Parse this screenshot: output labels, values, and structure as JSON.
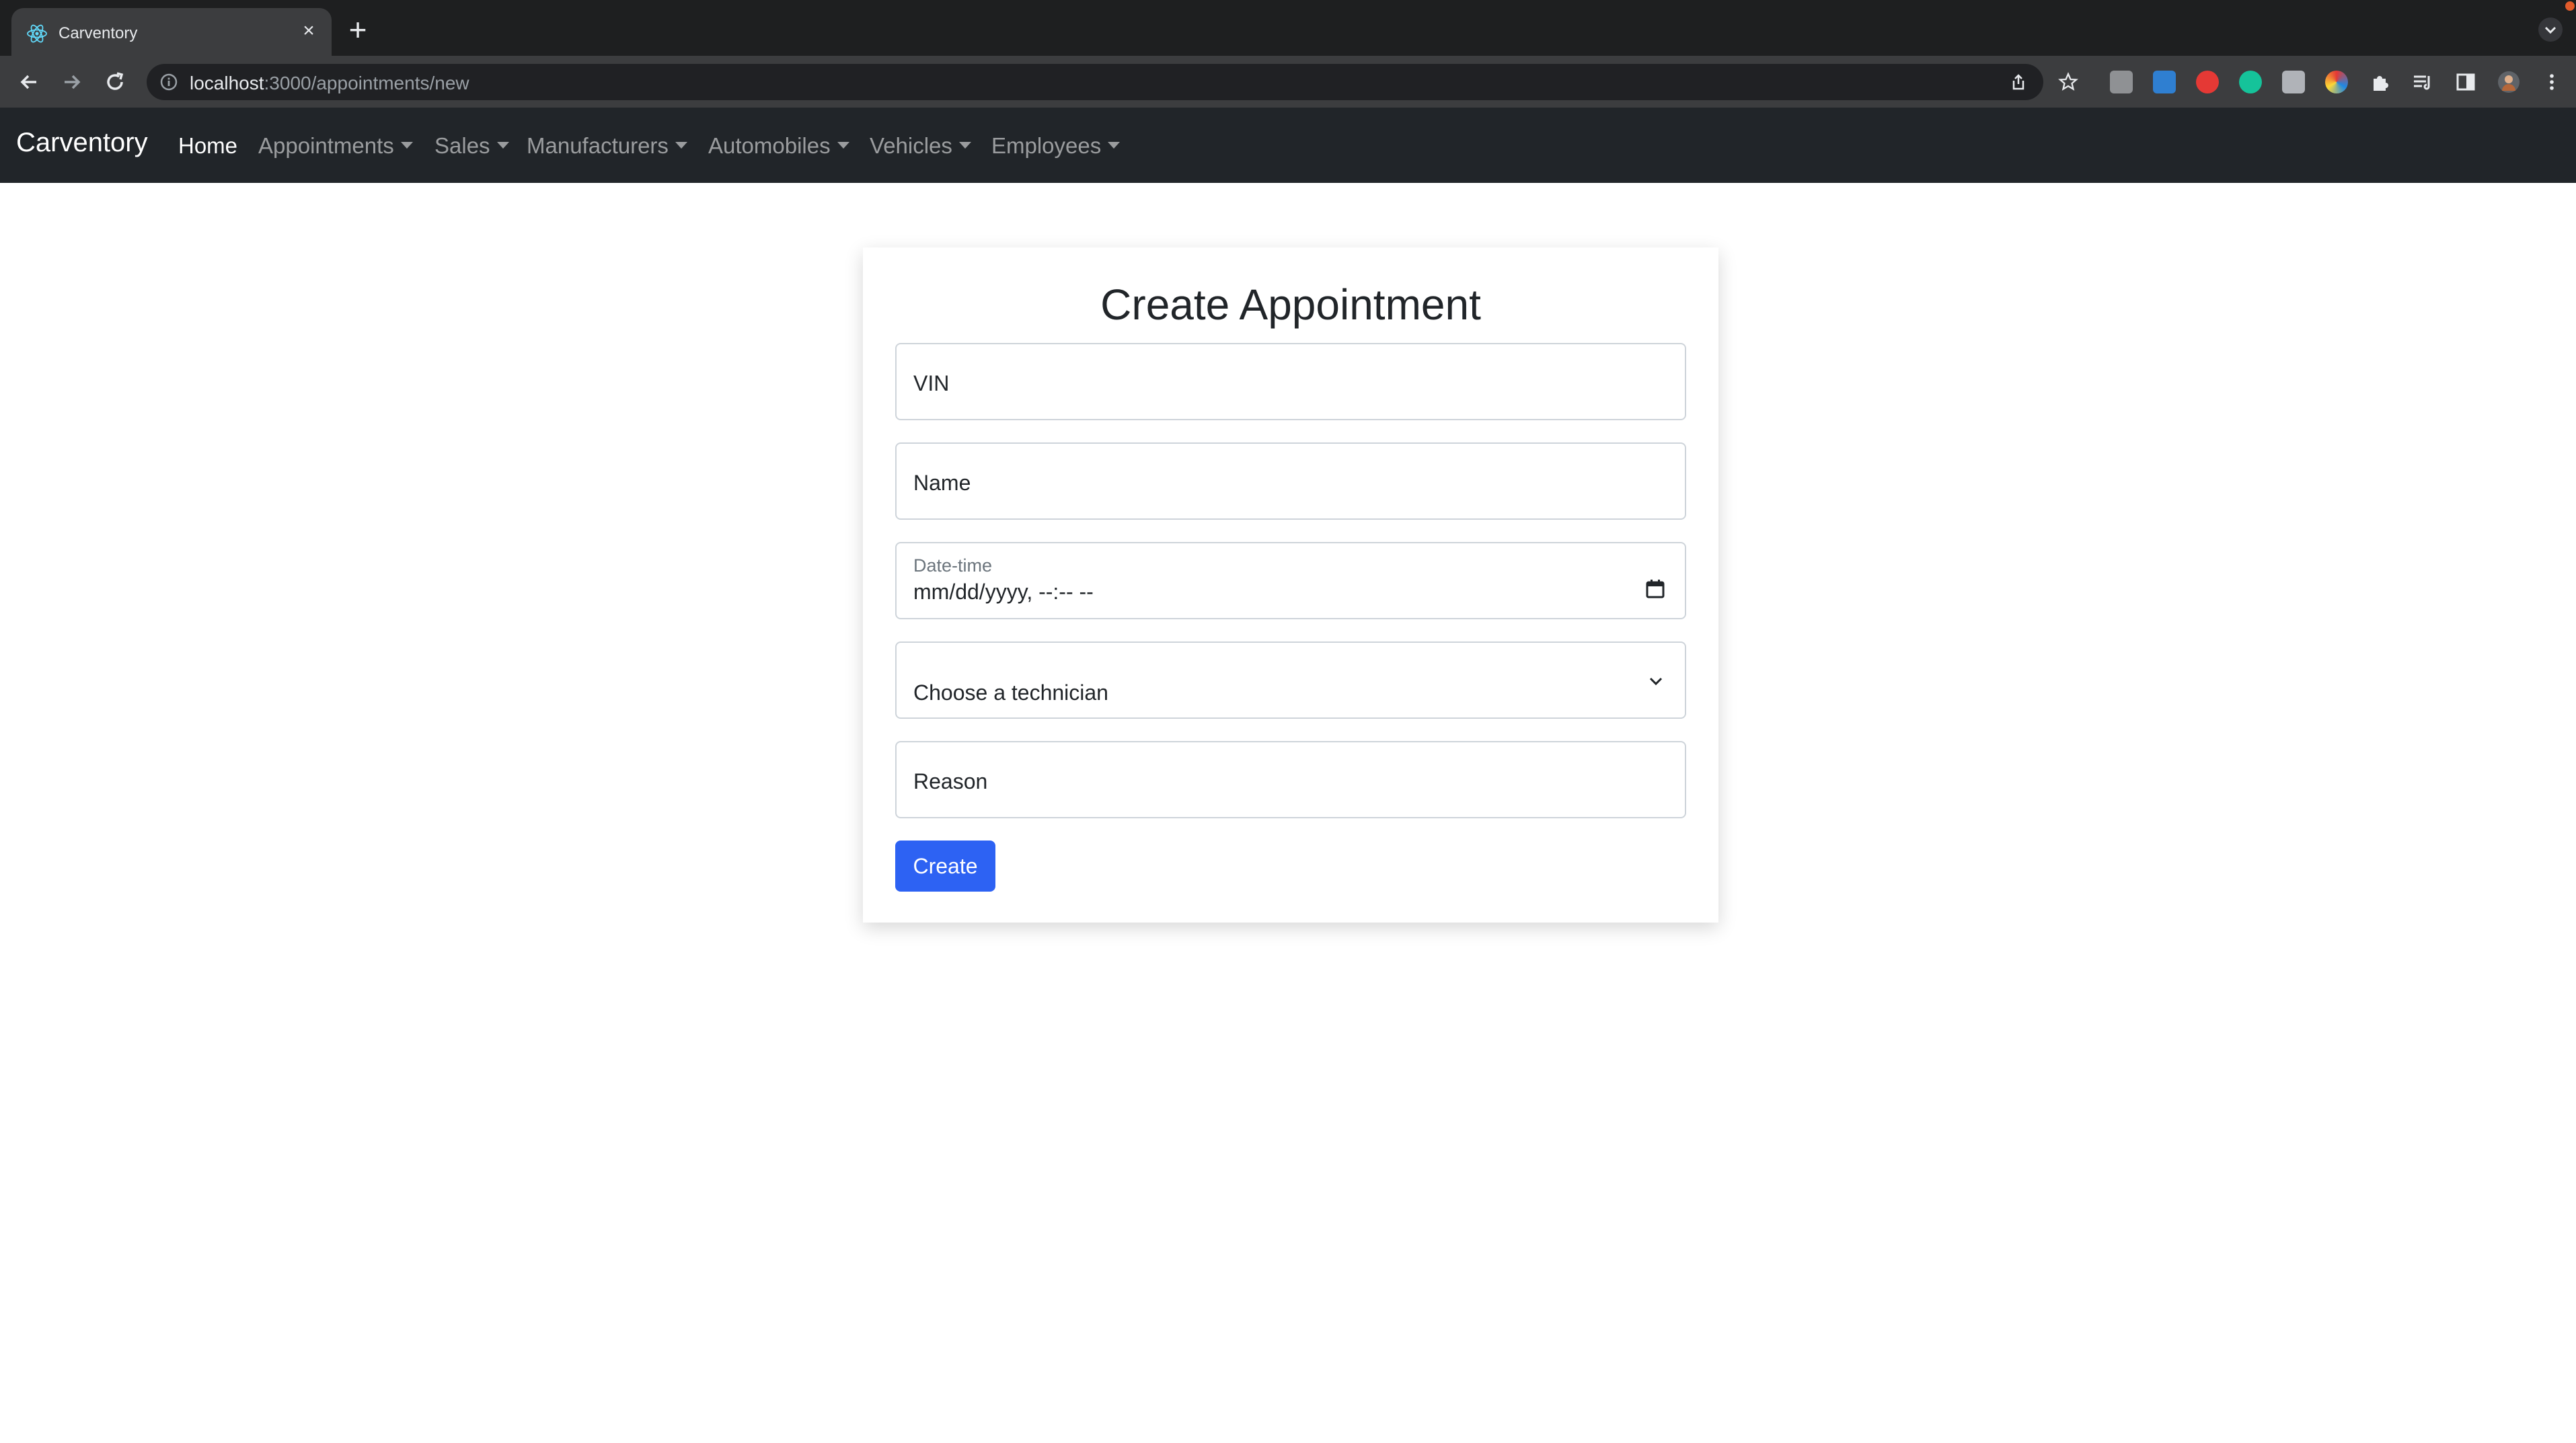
{
  "browser": {
    "tab_title": "Carventory",
    "url_host": "localhost",
    "url_path": ":3000/appointments/new",
    "icons": [
      "react-favicon-icon",
      "close-icon",
      "plus-icon",
      "back-icon",
      "forward-icon",
      "reload-icon",
      "info-icon",
      "share-icon",
      "star-icon",
      "extensions-icon",
      "reading-list-icon",
      "side-panel-icon",
      "profile-avatar",
      "more-menu-icon"
    ]
  },
  "navbar": {
    "brand": "Carventory",
    "items": [
      {
        "label": "Home"
      },
      {
        "label": "Appointments"
      },
      {
        "label": "Sales"
      },
      {
        "label": "Manufacturers"
      },
      {
        "label": "Automobiles"
      },
      {
        "label": "Vehicles"
      },
      {
        "label": "Employees"
      }
    ]
  },
  "form": {
    "title": "Create Appointment",
    "vin_placeholder": "VIN",
    "name_placeholder": "Name",
    "datetime_label": "Date-time",
    "datetime_value": "mm/dd/yyyy, --:-- --",
    "technician_placeholder": "Choose a technician",
    "reason_placeholder": "Reason",
    "submit_label": "Create"
  },
  "colors": {
    "navbar_bg": "#212529",
    "primary_button": "#2d62f3",
    "chrome_dark": "#1e1f20"
  }
}
